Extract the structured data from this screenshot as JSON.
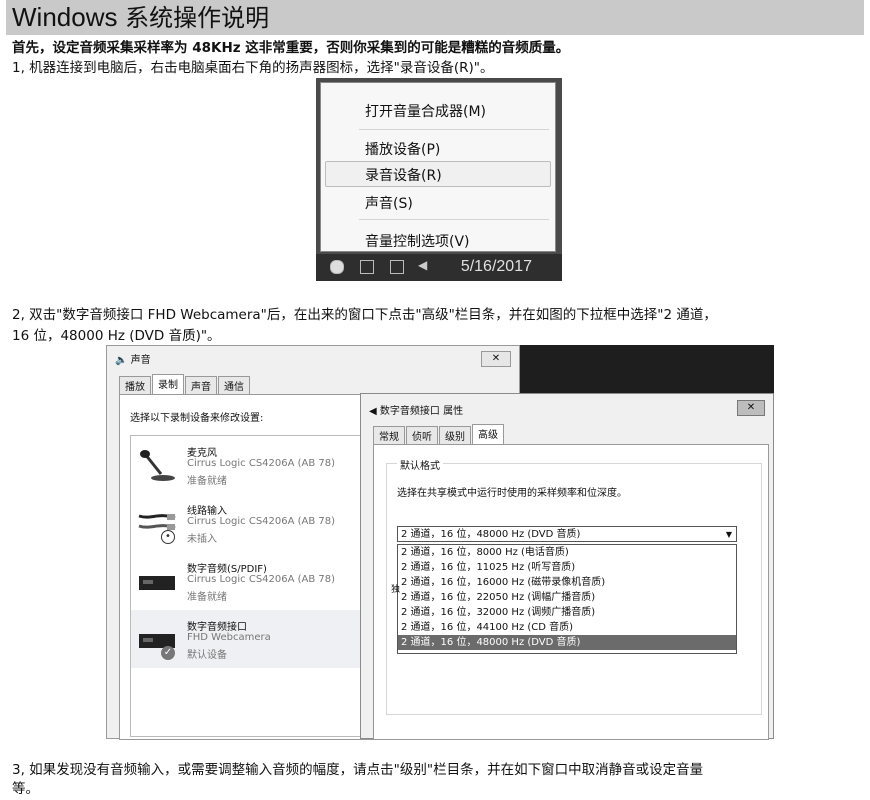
{
  "header": {
    "title_latin": "Windows",
    "title_cn": " 系统操作说明"
  },
  "intro": {
    "before": "首先，设定音频采集采样率为 ",
    "bold": "48KHz",
    "after": " 这非常重要，否则你采集到的可能是糟糕的音频质量。"
  },
  "step1": "1, 机器连接到电脑后，右击电脑桌面右下角的扬声器图标，选择\"录音设备(R)\"。",
  "context_menu": {
    "items": [
      "打开音量合成器(M)",
      "播放设备(P)",
      "录音设备(R)",
      "声音(S)",
      "音量控制选项(V)"
    ],
    "tray_time": "5/16/2017"
  },
  "step2_line1": "2, 双击\"数字音频接口 FHD Webcamera\"后，在出来的窗口下点击\"高级\"栏目条，并在如图的下拉框中选择\"2 通道，",
  "step2_line2": "16 位，48000 Hz (DVD 音质)\"。",
  "sound_window": {
    "title": "声音",
    "close": "✕",
    "tabs": [
      "播放",
      "录制",
      "声音",
      "通信"
    ],
    "intro": "选择以下录制设备来修改设置:",
    "devices": [
      {
        "name": "麦克风",
        "driver": "Cirrus Logic CS4206A (AB 78)",
        "status": "准备就绪"
      },
      {
        "name": "线路输入",
        "driver": "Cirrus Logic CS4206A (AB 78)",
        "status": "未插入"
      },
      {
        "name": "数字音频(S/PDIF)",
        "driver": "Cirrus Logic CS4206A (AB 78)",
        "status": "准备就绪"
      },
      {
        "name": "数字音频接口",
        "driver": "FHD Webcamera",
        "status": "默认设备"
      }
    ]
  },
  "props_window": {
    "title": "数字音频接口 属性",
    "close": "✕",
    "tabs": [
      "常规",
      "侦听",
      "级别",
      "高级"
    ],
    "group_label": "默认格式",
    "group_desc": "选择在共享模式中运行时使用的采样频率和位深度。",
    "selected": "2 通道，16 位，48000 Hz (DVD 音质)",
    "options": [
      "2 通道，16 位，8000 Hz (电话音质)",
      "2 通道，16 位，11025 Hz (听写音质)",
      "2 通道，16 位，16000 Hz (磁带录像机音质)",
      "2 通道，16 位，22050 Hz (调幅广播音质)",
      "2 通道，16 位，32000 Hz (调频广播音质)",
      "2 通道，16 位，44100 Hz (CD 音质)",
      "2 通道，16 位，48000 Hz (DVD 音质)"
    ],
    "partial_char": "独"
  },
  "step3_line1": "3, 如果发现没有音频输入，或需要调整输入音频的幅度，请点击\"级别\"栏目条，并在如下窗口中取消静音或设定音量",
  "step3_line2": "等。"
}
